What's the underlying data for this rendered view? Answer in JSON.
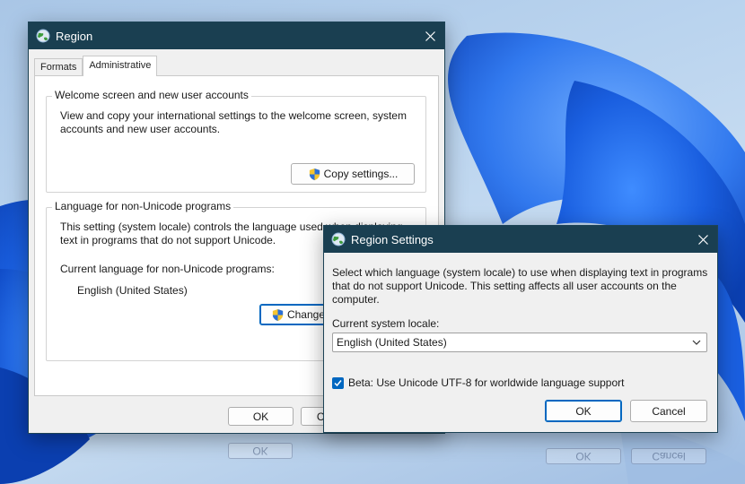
{
  "region_window": {
    "title": "Region",
    "tabs": [
      {
        "label": "Formats",
        "active": false
      },
      {
        "label": "Administrative",
        "active": true
      }
    ],
    "welcome_group": {
      "title": "Welcome screen and new user accounts",
      "description": "View and copy your international settings to the welcome screen, system accounts and new user accounts.",
      "copy_button": "Copy settings..."
    },
    "nonunicode_group": {
      "title": "Language for non-Unicode programs",
      "description": "This setting (system locale) controls the language used when displaying text in programs that do not support Unicode.",
      "current_label": "Current language for non-Unicode programs:",
      "current_value": "English (United States)",
      "change_button": "Change system locale..."
    },
    "ok_button": "OK",
    "cancel_button": "Cancel"
  },
  "settings_window": {
    "title": "Region Settings",
    "description": "Select which language (system locale) to use when displaying text in programs that do not support Unicode. This setting affects all user accounts on the computer.",
    "locale_label": "Current system locale:",
    "locale_value": "English (United States)",
    "beta_checkbox_label": "Beta: Use Unicode UTF-8 for worldwide language support",
    "beta_checked": true,
    "ok_button": "OK",
    "cancel_button": "Cancel"
  },
  "colors": {
    "titlebar": "#1a3f51",
    "accent": "#0067c0"
  },
  "icons": [
    "globe-icon",
    "close-icon",
    "uac-shield-icon",
    "chevron-down-icon",
    "checkmark-icon"
  ]
}
